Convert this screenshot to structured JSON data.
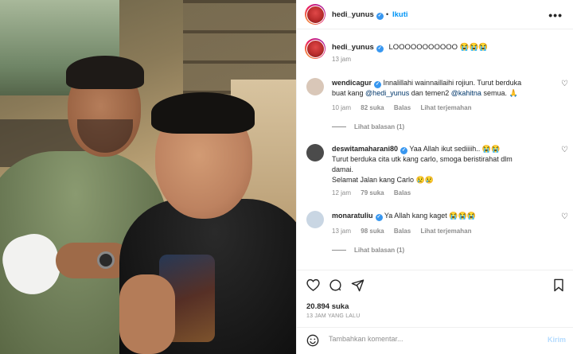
{
  "post": {
    "author": "hedi_yunus",
    "follow_label": "Ikuti",
    "more_label": "•••",
    "separator": "•"
  },
  "caption": {
    "author": "hedi_yunus",
    "text": "LOOOOOOOOOOO 😭😭😭",
    "time": "13 jam"
  },
  "comments": [
    {
      "username": "wendicagur",
      "text_pre": "Innalillahi wainnaillaihi rojiun. Turut berduka buat kang ",
      "mention1": "@hedi_yunus",
      "text_mid": " dan temen2 ",
      "mention2": "@kahitna",
      "text_post": " semua. 🙏",
      "time": "10 jam",
      "likes": "82 suka",
      "reply": "Balas",
      "translate": "Lihat terjemahan",
      "view_replies": "Lihat balasan (1)",
      "avatar_color": "#d9c7b8"
    },
    {
      "username": "deswitamaharani80",
      "text": "Yaa Allah ikut sediiiih.. 😭😭",
      "text_line2": "Turut berduka cita utk kang carlo, smoga beristirahat dlm damai.",
      "text_line3": "Selamat Jalan kang Carlo 😢😢",
      "time": "12 jam",
      "likes": "79 suka",
      "reply": "Balas",
      "avatar_color": "#4b4b4b"
    },
    {
      "username": "monaratuliu",
      "text": "Ya Allah kang kaget 😭😭😭",
      "time": "13 jam",
      "likes": "98 suka",
      "reply": "Balas",
      "translate": "Lihat terjemahan",
      "view_replies": "Lihat balasan (1)",
      "avatar_color": "#c9d6e3"
    }
  ],
  "actions": {
    "likes": "20.894 suka",
    "time_ago": "13 JAM YANG LALU"
  },
  "add_comment": {
    "placeholder": "Tambahkan komentar...",
    "post_label": "Kirim"
  },
  "icons": {
    "like": "heart-outline-icon",
    "comment": "comment-bubble-icon",
    "share": "paper-plane-icon",
    "save": "bookmark-icon",
    "emoji": "smiley-icon",
    "verified": "verified-badge-icon",
    "more": "more-dots-icon"
  },
  "colors": {
    "link": "#00376b",
    "accent": "#0095f6",
    "muted": "#8e8e8e",
    "verified": "#3897f0"
  }
}
